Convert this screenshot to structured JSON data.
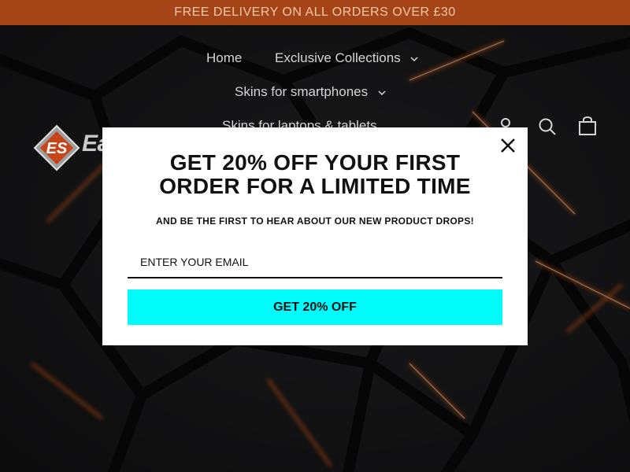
{
  "announcement": {
    "text": "FREE DELIVERY ON ALL ORDERS OVER £30"
  },
  "brand": {
    "name": "EasySkinz",
    "accent": "#a54417"
  },
  "nav": {
    "items": [
      {
        "label": "Home",
        "has_dropdown": false
      },
      {
        "label": "Exclusive Collections",
        "has_dropdown": true
      },
      {
        "label": "Skins for smartphones",
        "has_dropdown": true
      },
      {
        "label": "Skins for laptops & tablets",
        "has_dropdown": false
      }
    ]
  },
  "header_icons": [
    "user-icon",
    "search-icon",
    "cart-icon"
  ],
  "popup": {
    "title_line1": "GET 20% OFF YOUR FIRST",
    "title_line2": "ORDER FOR A LIMITED TIME",
    "subtitle": "AND BE THE FIRST TO HEAR ABOUT OUR NEW PRODUCT DROPS!",
    "email_placeholder": "ENTER YOUR EMAIL",
    "email_value": "",
    "cta_label": "GET 20% OFF",
    "cta_color": "#00fbfb",
    "close_icon": "close-icon"
  }
}
